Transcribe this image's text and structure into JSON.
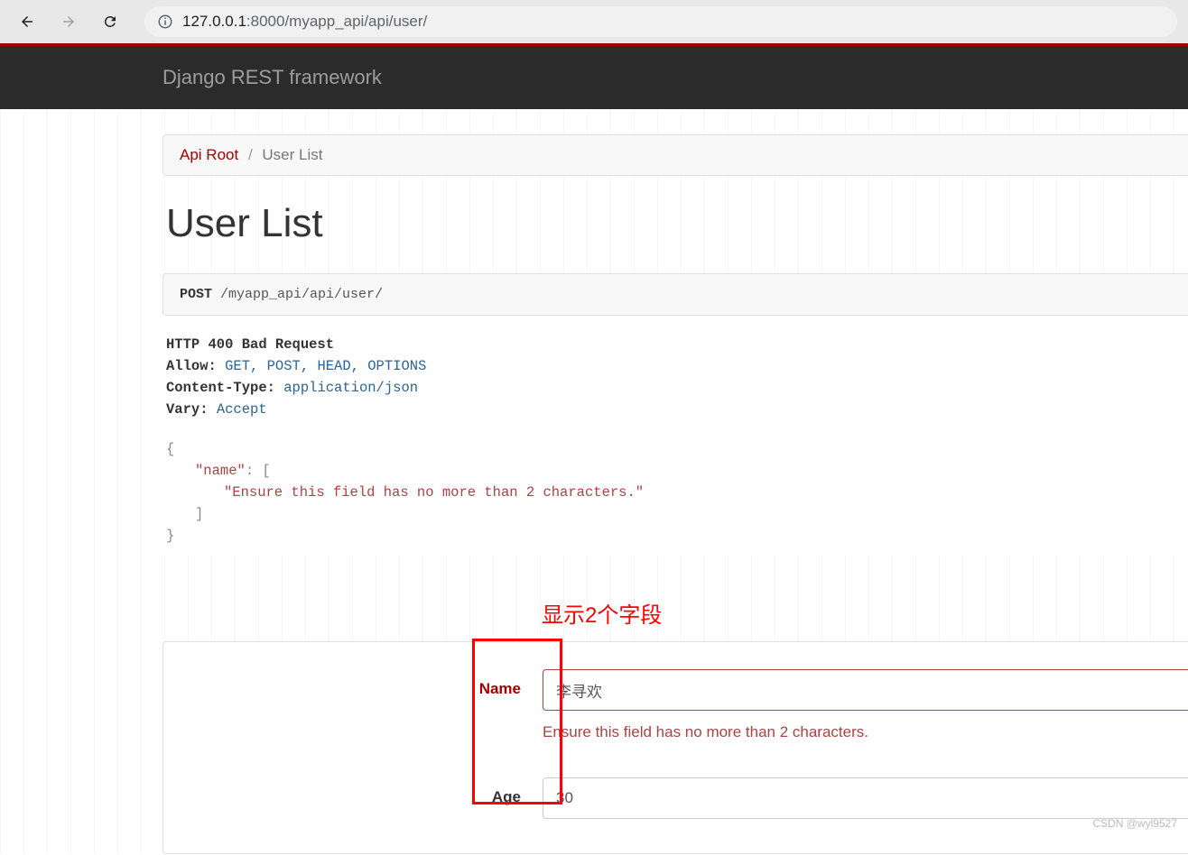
{
  "browser": {
    "url_host": "127.0.0.1",
    "url_port_path": ":8000/myapp_api/api/user/"
  },
  "navbar": {
    "brand": "Django REST framework"
  },
  "breadcrumb": {
    "root": "Api Root",
    "sep": "/",
    "current": "User List"
  },
  "page": {
    "title": "User List"
  },
  "request": {
    "method": "POST",
    "path": "/myapp_api/api/user/"
  },
  "response": {
    "status_line": "HTTP 400 Bad Request",
    "headers": [
      {
        "key": "Allow:",
        "value": "GET, POST, HEAD, OPTIONS"
      },
      {
        "key": "Content-Type:",
        "value": "application/json"
      },
      {
        "key": "Vary:",
        "value": "Accept"
      }
    ],
    "json": {
      "open": "{",
      "key": "\"name\"",
      "colon_bracket": ": [",
      "msg": "\"Ensure this field has no more than 2 characters.\"",
      "close_bracket": "]",
      "close": "}"
    }
  },
  "annotation": "显示2个字段",
  "form": {
    "name": {
      "label": "Name",
      "value": "李寻欢",
      "error": "Ensure this field has no more than 2 characters."
    },
    "age": {
      "label": "Age",
      "value": "30"
    }
  },
  "watermark": "CSDN @wyl9527"
}
